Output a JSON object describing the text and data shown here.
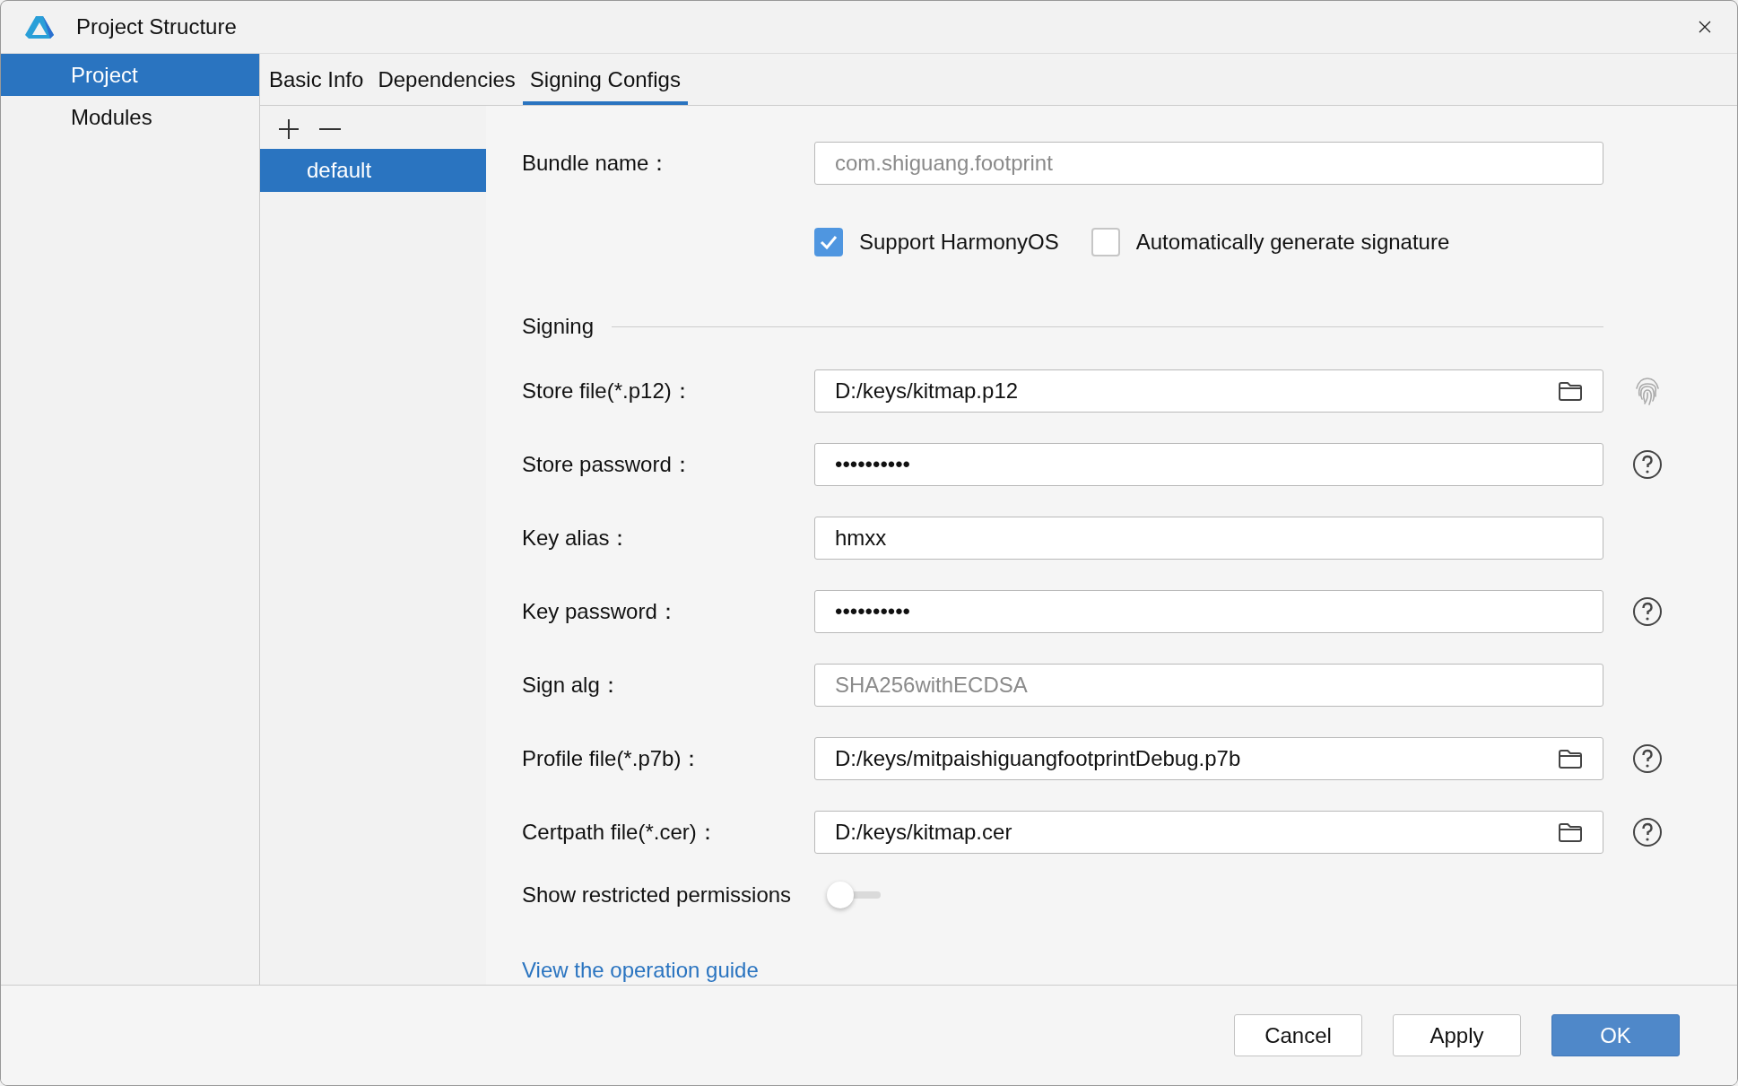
{
  "window": {
    "title": "Project Structure"
  },
  "sidebar": {
    "items": [
      {
        "label": "Project",
        "selected": true
      },
      {
        "label": "Modules",
        "selected": false
      }
    ]
  },
  "tabs": [
    {
      "label": "Basic Info",
      "selected": false
    },
    {
      "label": "Dependencies",
      "selected": false
    },
    {
      "label": "Signing Configs",
      "selected": true
    }
  ],
  "configs": [
    {
      "label": "default",
      "selected": true
    }
  ],
  "bundle": {
    "label": "Bundle name：",
    "value": "com.shiguang.footprint",
    "disabled": true
  },
  "options": [
    {
      "label": "Support HarmonyOS",
      "checked": true
    },
    {
      "label": "Automatically generate signature",
      "checked": false
    }
  ],
  "section": "Signing",
  "fields": [
    {
      "label": "Store file(*.p12)：",
      "value": "D:/keys/kitmap.p12",
      "disabled": false,
      "kind": "file",
      "fingerprint": true
    },
    {
      "label": "Store password：",
      "value": "••••••••••",
      "disabled": false,
      "kind": "text",
      "help": true
    },
    {
      "label": "Key alias：",
      "value": "hmxx",
      "disabled": false,
      "kind": "text"
    },
    {
      "label": "Key password：",
      "value": "••••••••••",
      "disabled": false,
      "kind": "text",
      "help": true
    },
    {
      "label": "Sign alg：",
      "value": "SHA256withECDSA",
      "disabled": true,
      "kind": "text"
    },
    {
      "label": "Profile file(*.p7b)：",
      "value": "D:/keys/mitpaishiguangfootprintDebug.p7b",
      "disabled": false,
      "kind": "file",
      "help": true
    },
    {
      "label": "Certpath file(*.cer)：",
      "value": "D:/keys/kitmap.cer",
      "disabled": false,
      "kind": "file",
      "help": true
    }
  ],
  "toggle": {
    "label": "Show restricted permissions",
    "on": false
  },
  "link": "View the operation guide",
  "buttons": [
    {
      "label": "Cancel",
      "kind": "secondary"
    },
    {
      "label": "Apply",
      "kind": "secondary"
    },
    {
      "label": "OK",
      "kind": "primary"
    }
  ]
}
